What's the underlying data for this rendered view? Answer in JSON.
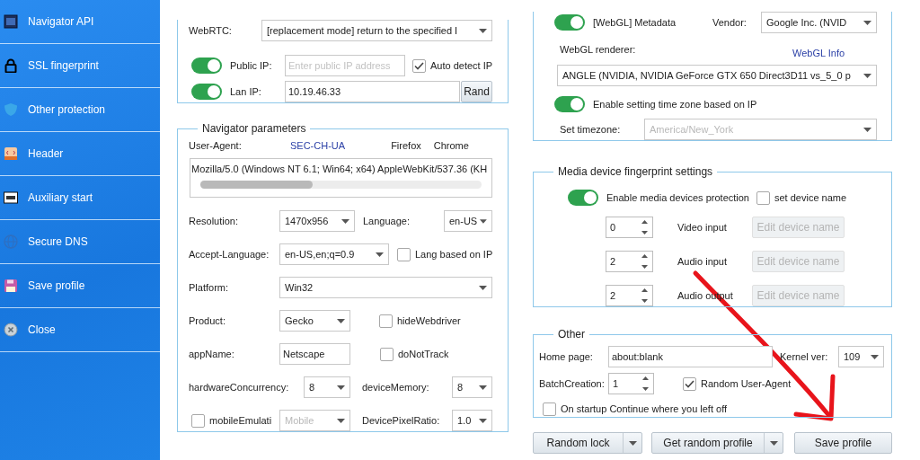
{
  "sidebar": {
    "items": [
      {
        "label": "Navigator API",
        "kind": "api"
      },
      {
        "label": "SSL fingerprint",
        "kind": "lock"
      },
      {
        "label": "Other protection",
        "kind": "shield"
      },
      {
        "label": "Header",
        "kind": "header"
      },
      {
        "label": "Auxiliary start",
        "kind": "cmd"
      },
      {
        "label": "Secure DNS",
        "kind": "dns"
      },
      {
        "label": "Save profile",
        "kind": "save"
      },
      {
        "label": "Close",
        "kind": "close"
      }
    ]
  },
  "webrtc": {
    "label": "WebRTC:",
    "value": "[replacement mode] return to the specified I"
  },
  "public_ip": {
    "on": true,
    "label": "Public IP:",
    "placeholder": "Enter public IP address",
    "auto_detect": {
      "label": "Auto detect IP",
      "checked": true
    }
  },
  "lan_ip": {
    "on": true,
    "label": "Lan IP:",
    "value": "10.19.46.33",
    "button": "Rand"
  },
  "navigator": {
    "title": "Navigator parameters",
    "user_agent_label": "User-Agent:",
    "sec_ch_ua_link": "SEC-CH-UA",
    "presets": [
      "Firefox",
      "Chrome"
    ],
    "user_agent": "Mozilla/5.0 (Windows NT 6.1; Win64; x64) AppleWebKit/537.36 (KH",
    "rows": [
      [
        {
          "kind": "label",
          "text": "Resolution:"
        },
        {
          "kind": "select",
          "value": "1470x956",
          "disabled": false
        },
        {
          "kind": "label",
          "text": "Language:"
        },
        {
          "kind": "select",
          "value": "en-US",
          "disabled": false
        }
      ],
      [
        {
          "kind": "label",
          "text": "Accept-Language:"
        },
        {
          "kind": "select",
          "value": "en-US,en;q=0.9",
          "disabled": false
        },
        {
          "kind": "checkbox",
          "label": "Lang based on IP",
          "checked": false
        }
      ],
      [
        {
          "kind": "label",
          "text": "Platform:"
        },
        {
          "kind": "select",
          "value": "Win32",
          "disabled": false
        }
      ],
      [
        {
          "kind": "label",
          "text": "Product:"
        },
        {
          "kind": "select",
          "value": "Gecko",
          "disabled": false
        },
        {
          "kind": "checkbox",
          "label": "hideWebdriver",
          "checked": false
        }
      ],
      [
        {
          "kind": "label",
          "text": "appName:"
        },
        {
          "kind": "input",
          "value": "Netscape"
        },
        {
          "kind": "checkbox",
          "label": "doNotTrack",
          "checked": false
        }
      ],
      [
        {
          "kind": "label",
          "text": "hardwareConcurrency:"
        },
        {
          "kind": "select",
          "value": "8",
          "disabled": false
        },
        {
          "kind": "label",
          "text": "deviceMemory:"
        },
        {
          "kind": "select",
          "value": "8",
          "disabled": false
        }
      ],
      [
        {
          "kind": "checkbox",
          "label": "mobileEmulati",
          "checked": false
        },
        {
          "kind": "select",
          "value": "Mobile",
          "disabled": true
        },
        {
          "kind": "label",
          "text": "DevicePixelRatio:"
        },
        {
          "kind": "select",
          "value": "1.0",
          "disabled": false
        }
      ]
    ]
  },
  "webgl": {
    "metadata": {
      "on": true,
      "label": "[WebGL] Metadata"
    },
    "vendor_label": "Vendor:",
    "vendor": "Google Inc. (NVID",
    "renderer_label": "WebGL renderer:",
    "info_link": "WebGL Info",
    "renderer": "ANGLE (NVIDIA, NVIDIA GeForce GTX 650 Direct3D11 vs_5_0 p"
  },
  "timezone": {
    "auto": {
      "on": true,
      "label": "Enable setting time zone based on IP"
    },
    "label": "Set timezone:",
    "value": "America/New_York",
    "disabled": true
  },
  "media": {
    "title": "Media device fingerprint settings",
    "protection": {
      "on": true,
      "label": "Enable media devices protection"
    },
    "set_name": {
      "label": "set device name",
      "checked": false
    },
    "devices": [
      {
        "count": "0",
        "label": "Video input",
        "button": "Edit device name",
        "disabled": true
      },
      {
        "count": "2",
        "label": "Audio input",
        "button": "Edit device name",
        "disabled": true
      },
      {
        "count": "2",
        "label": "Audio output",
        "button": "Edit device name",
        "disabled": true
      }
    ]
  },
  "other": {
    "title": "Other",
    "home_label": "Home page:",
    "home": "about:blank",
    "kernel_label": "Kernel ver:",
    "kernel": "109",
    "batch_label": "BatchCreation:",
    "batch": "1",
    "random_ua": {
      "label": "Random User-Agent",
      "checked": true
    },
    "continue": {
      "label": "On startup Continue where you left off",
      "checked": false
    }
  },
  "buttons": [
    {
      "label": "Random lock",
      "split": true
    },
    {
      "label": "Get random profile",
      "split": true
    },
    {
      "label": "Save profile",
      "split": false
    }
  ]
}
